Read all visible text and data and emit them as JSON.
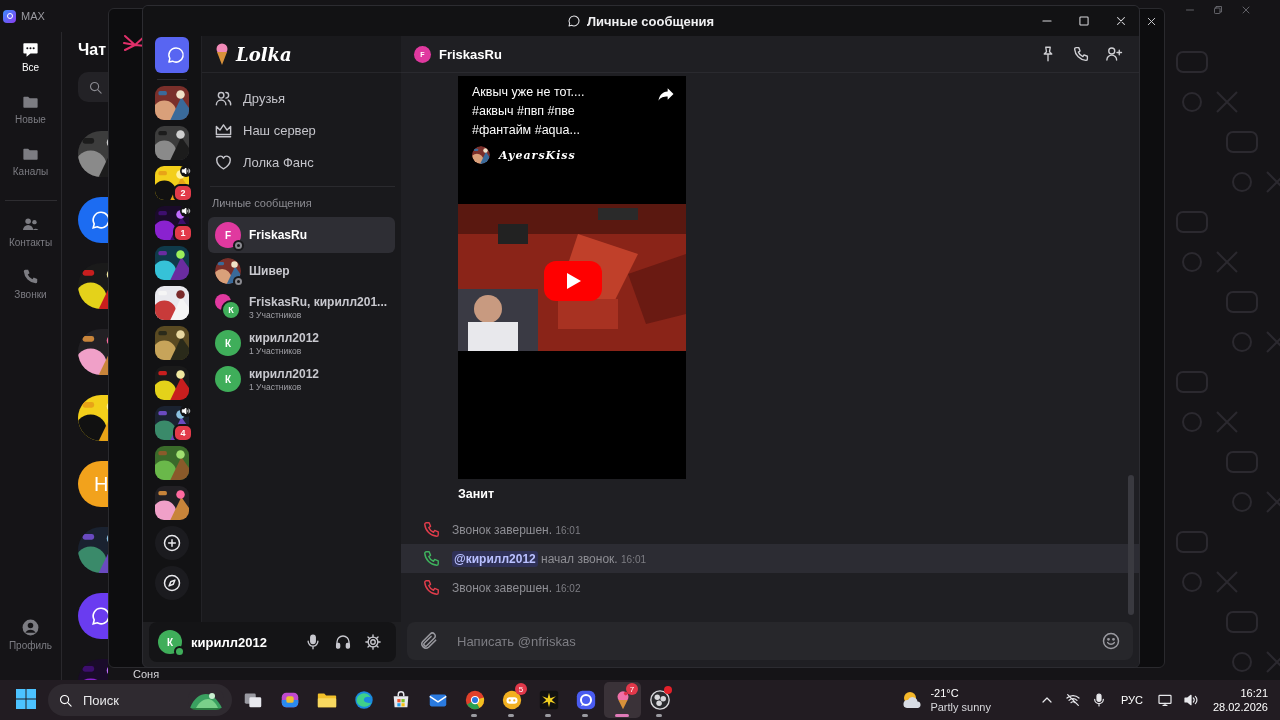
{
  "background_app": {
    "title": "MAX",
    "nav": [
      {
        "kind": "chats",
        "label": "Все",
        "selected": true
      },
      {
        "kind": "folder",
        "label": "Новые",
        "selected": false
      },
      {
        "kind": "folder",
        "label": "Каналы",
        "selected": false
      },
      {
        "kind": "contacts",
        "label": "Контакты",
        "selected": false
      },
      {
        "kind": "calls",
        "label": "Звонки",
        "selected": false
      }
    ],
    "profile": "Профиль",
    "heading": "Чат",
    "chats": [
      {
        "kind": "picture"
      },
      {
        "kind": "logo",
        "color": "#1c6cf2"
      },
      {
        "kind": "picture"
      },
      {
        "kind": "picture"
      },
      {
        "kind": "picture"
      },
      {
        "kind": "letter",
        "initial": "Н",
        "color": "#f2a21c"
      },
      {
        "kind": "picture"
      },
      {
        "kind": "logo",
        "color": "#6a3cf0"
      },
      {
        "kind": "picture",
        "name": "Соня"
      }
    ]
  },
  "window": {
    "title": "Личные сообщения"
  },
  "servers": [
    {
      "kind": "dm",
      "selected": true
    },
    {
      "kind": "picture",
      "selected": false,
      "voice": false
    },
    {
      "kind": "picture",
      "selected": false,
      "voice": false
    },
    {
      "kind": "picture",
      "selected": false,
      "voice": true,
      "badge": "2"
    },
    {
      "kind": "picture",
      "selected": false,
      "voice": true,
      "badge": "1"
    },
    {
      "kind": "picture",
      "selected": false,
      "voice": false
    },
    {
      "kind": "picture",
      "selected": false,
      "voice": false
    },
    {
      "kind": "picture",
      "selected": false,
      "voice": false
    },
    {
      "kind": "picture",
      "selected": false,
      "voice": false
    },
    {
      "kind": "picture",
      "selected": false,
      "voice": true,
      "badge": "4"
    },
    {
      "kind": "picture",
      "selected": false,
      "voice": false
    },
    {
      "kind": "picture",
      "selected": false,
      "voice": false
    },
    {
      "kind": "add",
      "selected": false
    },
    {
      "kind": "explore",
      "selected": false
    }
  ],
  "sidebar": {
    "brand": "Lolka",
    "nav": [
      {
        "kind": "friends",
        "label": "Друзья"
      },
      {
        "kind": "crown",
        "label": "Наш сервер"
      },
      {
        "kind": "heart",
        "label": "Лолка Фанс"
      }
    ],
    "section": "Личные сообщения",
    "dms": [
      {
        "kind": "user",
        "name": "FriskasRu",
        "initial": "F",
        "color": "#e0399f",
        "offline": true,
        "selected": true
      },
      {
        "kind": "picture",
        "name": "Шивер",
        "offline": true,
        "selected": false
      },
      {
        "kind": "group",
        "name": "FriskasRu, кирилл201...",
        "subtitle": "3 Участников",
        "initial": "К",
        "color": "#3fae5a",
        "offline": false,
        "selected": false
      },
      {
        "kind": "user",
        "name": "кирилл2012",
        "subtitle": "1 Участников",
        "initial": "К",
        "color": "#3fae5a",
        "offline": false,
        "selected": false
      },
      {
        "kind": "user",
        "name": "кирилл2012",
        "subtitle": "1 Участников",
        "initial": "К",
        "color": "#3fae5a",
        "offline": false,
        "selected": false
      }
    ]
  },
  "user_panel": {
    "initial": "К",
    "name": "кирилл2012",
    "online": true
  },
  "chat": {
    "header": {
      "initial": "F",
      "name": "FriskasRu"
    },
    "embed": {
      "title": "Аквыч уже не тот....\n#аквыч #пвп #пве\n#фантайм #aqua...",
      "author": "AyearsKiss"
    },
    "message": "Занит",
    "calls": [
      {
        "kind": "ended",
        "text": "Звонок завершен.",
        "time": "16:01",
        "highlighted": false
      },
      {
        "kind": "started",
        "mention": "@кирилл2012",
        "text": "начал звонок.",
        "time": "16:01",
        "highlighted": true
      },
      {
        "kind": "ended",
        "text": "Звонок завершен.",
        "time": "16:02",
        "highlighted": false
      }
    ],
    "composer": {
      "placeholder": "Написать @nfriskas"
    }
  },
  "taskbar": {
    "search": {
      "placeholder": "Поиск"
    },
    "apps": [
      {
        "kind": "taskview",
        "running": false,
        "active": false
      },
      {
        "kind": "copilot",
        "running": false,
        "active": false
      },
      {
        "kind": "folder",
        "running": false,
        "active": false
      },
      {
        "kind": "swirl",
        "running": false,
        "active": false
      },
      {
        "kind": "store",
        "running": false,
        "active": false
      },
      {
        "kind": "mail",
        "running": false,
        "active": false
      },
      {
        "kind": "tricolor",
        "running": true,
        "active": false
      },
      {
        "kind": "gamepad",
        "running": true,
        "active": false,
        "badge": "5"
      },
      {
        "kind": "starburst",
        "running": true,
        "active": false
      },
      {
        "kind": "chatapp",
        "running": true,
        "active": false
      },
      {
        "kind": "icecream",
        "running": true,
        "active": true,
        "badge": "7"
      },
      {
        "kind": "aperture",
        "running": true,
        "active": false,
        "dot": true
      }
    ],
    "weather": {
      "temp": "-21°C",
      "desc": "Partly sunny"
    },
    "language": "РУС",
    "time": "16:21",
    "date": "28.02.2026"
  }
}
